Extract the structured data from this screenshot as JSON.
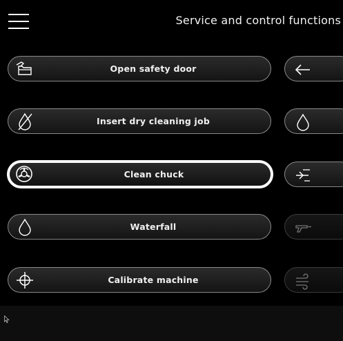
{
  "header": {
    "title": "Service and control functions",
    "menu_icon": "hamburger-menu-icon"
  },
  "functions": [
    {
      "label": "Open safety door",
      "icon": "open-door-icon",
      "active": false
    },
    {
      "label": "Insert dry cleaning job",
      "icon": "no-water-drop-icon",
      "active": false
    },
    {
      "label": "Clean chuck",
      "icon": "chuck-icon",
      "active": true
    },
    {
      "label": "Waterfall",
      "icon": "water-drop-icon",
      "active": false
    },
    {
      "label": "Calibrate machine",
      "icon": "crosshair-icon",
      "active": false
    }
  ],
  "side_functions": [
    {
      "icon": "arrow-left-icon",
      "enabled": true
    },
    {
      "icon": "water-drop-icon",
      "enabled": true
    },
    {
      "icon": "spray-arrows-icon",
      "enabled": true
    },
    {
      "icon": "spray-gun-icon",
      "enabled": false
    },
    {
      "icon": "air-blow-icon",
      "enabled": false
    }
  ],
  "colors": {
    "background": "#000000",
    "pill_border": "#8a8a8a",
    "active_border": "#ffffff",
    "text": "#f0f0f0"
  }
}
